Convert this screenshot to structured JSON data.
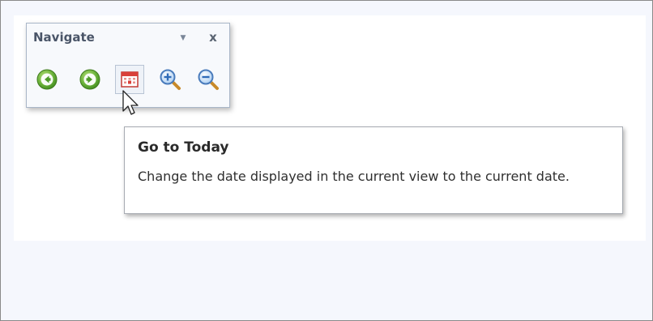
{
  "navigate_panel": {
    "title": "Navigate",
    "dropdown_icon": "chevron-down-icon",
    "close_label": "x",
    "buttons": [
      {
        "name": "back-button",
        "icon": "arrow-left-circle-icon",
        "color": "#5aa832"
      },
      {
        "name": "forward-button",
        "icon": "arrow-right-circle-icon",
        "color": "#5aa832"
      },
      {
        "name": "go-to-today-button",
        "icon": "calendar-today-icon",
        "color": "#d9403a",
        "hovered": true
      },
      {
        "name": "zoom-in-button",
        "icon": "zoom-in-icon",
        "color": "#3a78c8"
      },
      {
        "name": "zoom-out-button",
        "icon": "zoom-out-icon",
        "color": "#3a78c8"
      }
    ]
  },
  "tooltip": {
    "title": "Go to Today",
    "body": "Change the date displayed in the current view to the current date."
  },
  "colors": {
    "background": "#f5f7fd",
    "canvas": "#ffffff",
    "panel_border": "#a9b6c8",
    "title_text": "#4a5568"
  }
}
